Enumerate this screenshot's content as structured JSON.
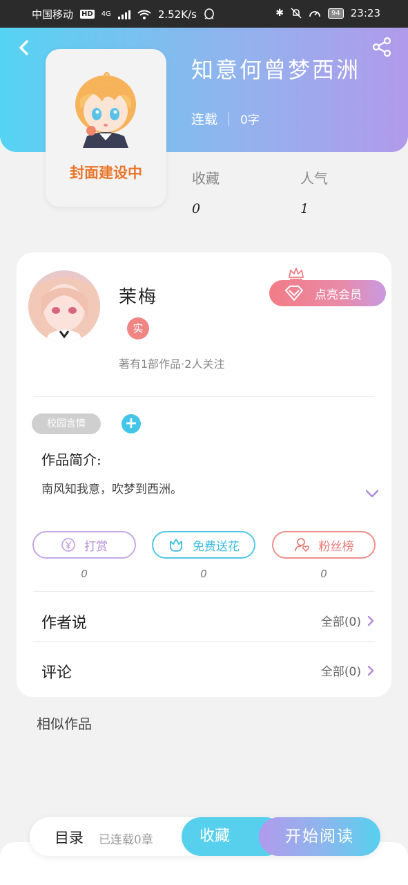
{
  "status_bar": {
    "carrier": "中国移动",
    "hd": "HD",
    "network": "4G",
    "speed": "2.52K/s",
    "battery": "94",
    "time": "23:23"
  },
  "book": {
    "title": "知意何曾梦西洲",
    "status": "连载",
    "word_count": "0字",
    "cover_text": "封面建设中"
  },
  "stats": {
    "favorites_label": "收藏",
    "favorites_value": "0",
    "popularity_label": "人气",
    "popularity_value": "1"
  },
  "author": {
    "name": "茉梅",
    "verified_badge": "实",
    "summary": "著有1部作品·2人关注",
    "vip_label": "点亮会员"
  },
  "tags": {
    "tag1": "校园言情",
    "add_label": "+"
  },
  "intro": {
    "label": "作品简介:",
    "text": "南风知我意，吹梦到西洲。"
  },
  "actions": {
    "reward_label": "打赏",
    "reward_count": "0",
    "flower_label": "免费送花",
    "flower_count": "0",
    "fans_label": "粉丝榜",
    "fans_count": "0"
  },
  "rows": {
    "author_say_label": "作者说",
    "author_say_right": "全部(0)",
    "comment_label": "评论",
    "comment_right": "全部(0)"
  },
  "similar_label": "相似作品",
  "bottom": {
    "toc_label": "目录",
    "toc_sub": "已连载0章",
    "fav_label": "收藏",
    "read_label": "开始阅读"
  },
  "colors": {
    "header_start": "#55d3f2",
    "header_end": "#b19aeb",
    "cover_text": "#e9762b",
    "accent_blue": "#45c6e8"
  }
}
